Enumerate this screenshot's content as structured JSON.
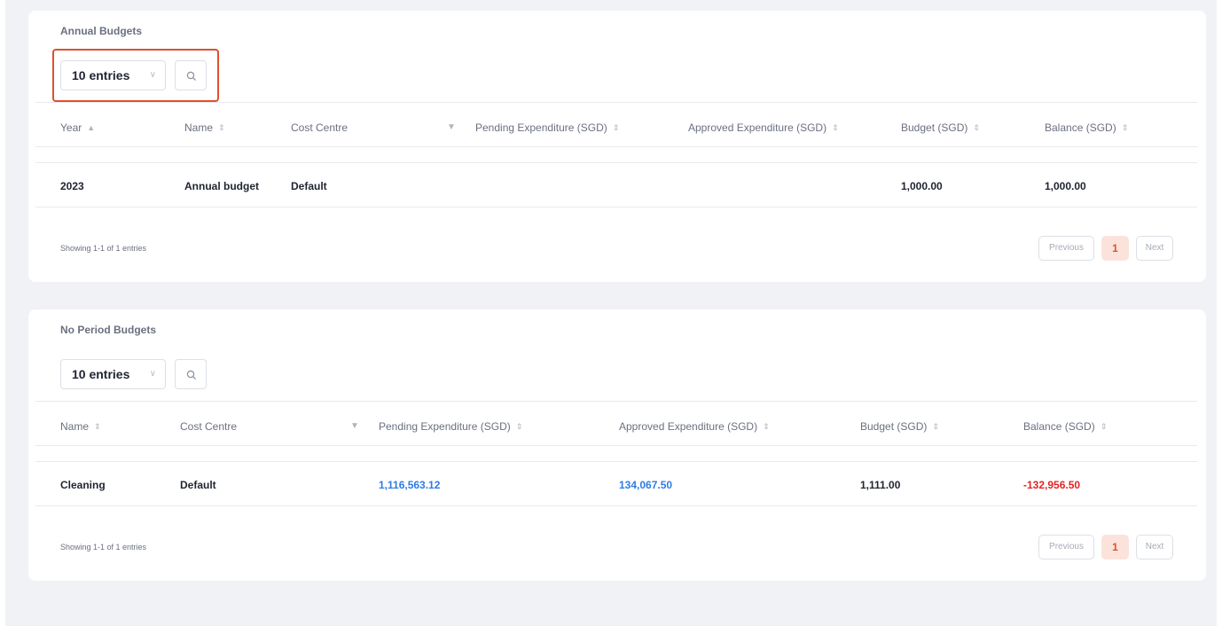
{
  "annual": {
    "title": "Annual Budgets",
    "entries_select": "10 entries",
    "headers": {
      "year": "Year",
      "name": "Name",
      "cost_centre": "Cost Centre",
      "pending": "Pending Expenditure (SGD)",
      "approved": "Approved Expenditure (SGD)",
      "budget": "Budget (SGD)",
      "balance": "Balance (SGD)"
    },
    "rows": [
      {
        "year": "2023",
        "name": "Annual budget",
        "cost_centre": "Default",
        "pending": "",
        "approved": "",
        "budget": "1,000.00",
        "balance": "1,000.00"
      }
    ],
    "footer": "Showing 1-1 of 1 entries",
    "pagination": {
      "previous": "Previous",
      "current": "1",
      "next": "Next"
    }
  },
  "no_period": {
    "title": "No Period Budgets",
    "entries_select": "10 entries",
    "headers": {
      "name": "Name",
      "cost_centre": "Cost Centre",
      "pending": "Pending Expenditure (SGD)",
      "approved": "Approved Expenditure (SGD)",
      "budget": "Budget (SGD)",
      "balance": "Balance (SGD)"
    },
    "rows": [
      {
        "name": "Cleaning",
        "cost_centre": "Default",
        "pending": "1,116,563.12",
        "approved": "134,067.50",
        "budget": "1,111.00",
        "balance": "-132,956.50"
      }
    ],
    "footer": "Showing 1-1 of 1 entries",
    "pagination": {
      "previous": "Previous",
      "current": "1",
      "next": "Next"
    }
  },
  "icons": {
    "sort": "sort-icon",
    "filter": "funnel-icon",
    "search": "search-icon",
    "dropdown": "chevron-down-icon"
  },
  "colors": {
    "accent": "#e0502b",
    "link_blue": "#2f7be6",
    "negative_red": "#e02424"
  }
}
